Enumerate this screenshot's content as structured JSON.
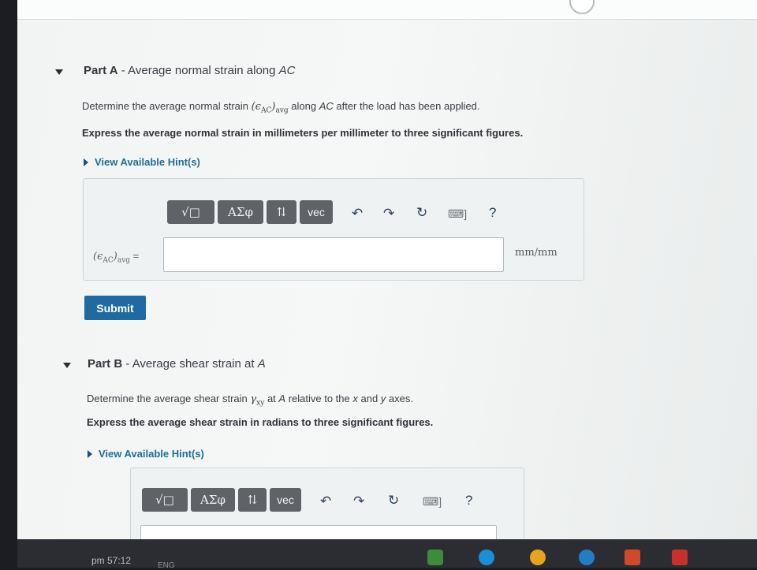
{
  "partA": {
    "title_prefix": "Part A",
    "title_dash": " - ",
    "title_text": "Average normal strain along ",
    "title_var": "AC",
    "question_pre": "Determine the average normal strain ",
    "question_symbol": "(ϵ",
    "question_symbol_sub": "AC",
    "question_symbol_close": ")",
    "question_symbol_avg": "avg",
    "question_post_pre": " along ",
    "question_post_var": "AC",
    "question_post_post": " after the load has been applied.",
    "instruction": "Express the average normal strain in millimeters per millimeter to three significant figures.",
    "hint_label": "View Available Hint(s)",
    "answer_label": "(ϵ",
    "answer_label_sub": "AC",
    "answer_label_close": ")",
    "answer_label_avg": "avg",
    "answer_eq": " =",
    "input_value": "",
    "units": "mm/mm",
    "submit_label": "Submit"
  },
  "partB": {
    "title_prefix": "Part B",
    "title_dash": " - ",
    "title_text": "Average shear strain at ",
    "title_var": "A",
    "question_pre": "Determine the average shear strain ",
    "question_symbol": "γ",
    "question_symbol_sub": "xy",
    "question_post_pre": " at ",
    "question_post_var": "A",
    "question_post_mid": " relative to the ",
    "question_x": "x",
    "question_and": " and ",
    "question_y": "y",
    "question_post_post": " axes.",
    "instruction": "Express the average shear strain in radians to three significant figures.",
    "hint_label": "View Available Hint(s)"
  },
  "toolbar": {
    "template_btn": "√□",
    "greek_btn": "ΑΣφ",
    "arrows_btn": "⇅",
    "vec_btn": "vec",
    "undo_icon": "undo-icon",
    "redo_icon": "redo-icon",
    "reset_icon": "reset-icon",
    "keyboard_icon": "keyboard-icon",
    "help_label": "?"
  },
  "taskbar": {
    "clock": "pm 57:12",
    "tray_text": "ENG"
  },
  "colors": {
    "accent_blue": "#1f6aa0",
    "hint_blue": "#1c6f95",
    "toolbar_gray": "#5f6368"
  }
}
